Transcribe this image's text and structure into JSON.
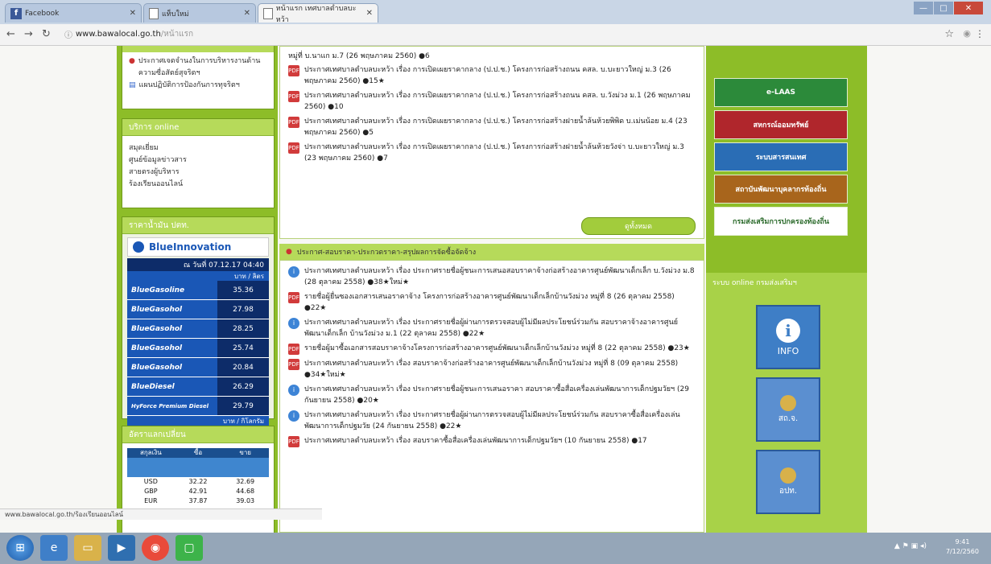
{
  "browser": {
    "tabs": [
      {
        "label": "Facebook"
      },
      {
        "label": "แท็บใหม่"
      },
      {
        "label": "หน้าแรก เทศบาลตำบลบะหว้า"
      }
    ],
    "url_domain": "www.bawalocal.go.th",
    "url_path": "/หน้าแรก"
  },
  "left": {
    "top_links": [
      "ประกาศเจตจำนงในการบริหารงานด้านความซื่อสัตย์สุจริตฯ",
      "แผนปฏิบัติการป้องกันการทุจริตฯ"
    ],
    "services_title": "บริการ online",
    "services": [
      "สมุดเยี่ยม",
      "ศูนย์ข้อมูลข่าวสาร",
      "สายตรงผู้บริหาร",
      "ร้องเรียนออนไลน์"
    ],
    "oil_title": "ราคาน้ำมัน ปตท.",
    "oil_brand": "BlueInnovation",
    "oil_date": "ณ วันที่ 07.12.17 04:40",
    "oil_unit": "บาท / ลิตร",
    "oil_rates": [
      {
        "name": "BlueGasoline",
        "price": "35.36"
      },
      {
        "name": "BlueGasohol",
        "price": "27.98"
      },
      {
        "name": "BlueGasohol",
        "price": "28.25"
      },
      {
        "name": "BlueGasohol",
        "price": "25.74"
      },
      {
        "name": "BlueGasohol",
        "price": "20.84"
      },
      {
        "name": "BlueDiesel",
        "price": "26.29"
      },
      {
        "name": "HyForce Premium Diesel",
        "price": "29.79"
      }
    ],
    "oil_footer": "บาท / กิโลกรัม",
    "exchange_title": "อัตราแลกเปลี่ยน",
    "exchange_headers": [
      "สกุลเงิน",
      "ซื้อ",
      "ขาย"
    ],
    "exchange_rows": [
      {
        "cur": "USD",
        "buy": "32.22",
        "sell": "32.69"
      },
      {
        "cur": "GBP",
        "buy": "42.91",
        "sell": "44.68"
      },
      {
        "cur": "EUR",
        "buy": "37.87",
        "sell": "39.03"
      }
    ]
  },
  "main": {
    "top_cut": "หมู่ที่ บ.นาแก ม.7 (26 พฤษภาคม 2560) ●6",
    "news1": [
      {
        "text": "ประกาศเทศบาลตำบลบะหว้า เรื่อง การเปิดเผยราคากลาง (ป.ป.ช.) โครงการก่อสร้างถนน คสล. บ.บะยาวใหญ่ ม.3 (26 พฤษภาคม 2560) ●15★"
      },
      {
        "text": "ประกาศเทศบาลตำบลบะหว้า เรื่อง การเปิดเผยราคากลาง (ป.ป.ช.) โครงการก่อสร้างถนน คสล. บ.วังม่วง ม.1 (26 พฤษภาคม 2560) ●10"
      },
      {
        "text": "ประกาศเทศบาลตำบลบะหว้า เรื่อง การเปิดเผยราคากลาง (ป.ป.ช.) โครงการก่อสร้างฝายน้ำล้นห้วยพิพิด บ.เม่นน้อย ม.4 (23 พฤษภาคม 2560) ●5"
      },
      {
        "text": "ประกาศเทศบาลตำบลบะหว้า เรื่อง การเปิดเผยราคากลาง (ป.ป.ช.) โครงการก่อสร้างฝายน้ำล้นห้วยวังจ่า บ.บะยาวใหญ่ ม.3 (23 พฤษภาคม 2560) ●7"
      }
    ],
    "view_all": "ดูทั้งหมด",
    "section2_title": "ประกาศ-สอบราคา-ประกวดราคา-สรุปผลการจัดซื้อจัดจ้าง",
    "news2": [
      {
        "icon": "info",
        "text": "ประกาศเทศบาลตำบลบะหว้า เรื่อง ประกาศรายชื่อผู้ชนะการเสนอสอบราคาจ้างก่อสร้างอาคารศูนย์พัฒนาเด็กเล็ก บ.วังม่วง ม.8 (28 ตุลาคม 2558) ●38★ใหม่★"
      },
      {
        "icon": "pdf",
        "text": "รายชื่อผู้ยื่นซองเอกสารเสนอราคาจ้าง โครงการก่อสร้างอาคารศูนย์พัฒนาเด็กเล็กบ้านวังม่วง หมู่ที่ 8 (26 ตุลาคม 2558) ●22★"
      },
      {
        "icon": "info",
        "text": "ประกาศเทศบาลตำบลบะหว้า เรื่อง ประกาศรายชื่อผู้ผ่านการตรวจสอบผู้ไม่มีผลประโยชน์ร่วมกัน สอบราคาจ้างอาคารศูนย์พัฒนาเด็กเล็ก บ้านวังม่วง ม.1 (22 ตุลาคม 2558) ●22★"
      },
      {
        "icon": "pdf",
        "text": "รายชื่อผู้มาซื้อเอกสารสอบราคาจ้างโครงการก่อสร้างอาคารศูนย์พัฒนาเด็กเล็กบ้านวังม่วง หมู่ที่ 8 (22 ตุลาคม 2558) ●23★"
      },
      {
        "icon": "pdf",
        "text": "ประกาศเทศบาลตำบลบะหว้า เรื่อง สอบราคาจ้างก่อสร้างอาคารศูนย์พัฒนาเด็กเล็กบ้านวังม่วง หมู่ที่ 8 (09 ตุลาคม 2558) ●34★ใหม่★"
      },
      {
        "icon": "info",
        "text": "ประกาศเทศบาลตำบลบะหว้า เรื่อง ประกาศรายชื่อผู้ชนะการเสนอราคา สอบราคาซื้อสื่อเครื่องเล่นพัฒนาการเด็กปฐมวัยฯ (29 กันยายน 2558) ●20★"
      },
      {
        "icon": "info",
        "text": "ประกาศเทศบาลตำบลบะหว้า เรื่อง ประกาศรายชื่อผู้ผ่านการตรวจสอบผู้ไม่มีผลประโยชน์ร่วมกัน สอบราคาซื้อสื่อเครื่องเล่นพัฒนาการเด็กปฐมวัย (24 กันยายน 2558) ●22★"
      },
      {
        "icon": "pdf",
        "text": "ประกาศเทศบาลตำบลบะหว้า เรื่อง สอบราคาซื้อสื่อเครื่องเล่นพัฒนาการเด็กปฐมวัยฯ (10 กันยายน 2558) ●17"
      }
    ]
  },
  "right": {
    "banners": [
      "e-LAAS",
      "สหกรณ์ออมทรัพย์",
      "ระบบสารสนเทศ",
      "สถาบันพัฒนาบุคลากรท้องถิ่น",
      "กรมส่งเสริมการปกครองท้องถิ่น"
    ],
    "online_title": "ระบบ online กรมส่งเสริมฯ",
    "info_label": "INFO",
    "buttons": [
      "สถ.จ.",
      "อปท."
    ]
  },
  "status_text": "www.bawalocal.go.th/ร้องเรียนออนไลน์",
  "clock": {
    "time": "9:41",
    "date": "7/12/2560"
  }
}
